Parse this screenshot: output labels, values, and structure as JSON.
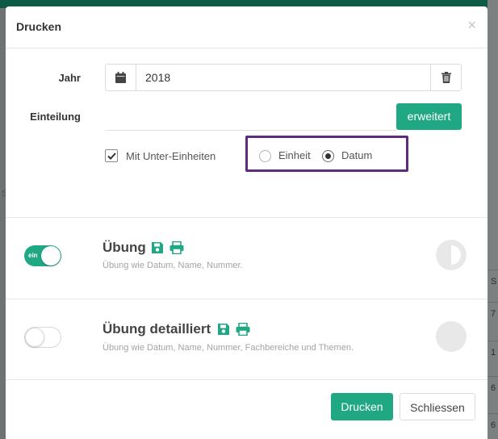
{
  "modal": {
    "title": "Drucken",
    "close": "×"
  },
  "form": {
    "year_label": "Jahr",
    "year_value": "2018",
    "einteilung_label": "Einteilung",
    "erweitert_button": "erweitert",
    "checkbox_label": "Mit Unter-Einheiten",
    "checkbox_checked": true,
    "radio_options": [
      {
        "label": "Einheit",
        "selected": false
      },
      {
        "label": "Datum",
        "selected": true
      }
    ]
  },
  "sections": [
    {
      "title": "Übung",
      "description": "Übung wie Datum, Name, Nummer.",
      "toggle_on": true,
      "toggle_text": "ein",
      "status": "half"
    },
    {
      "title": "Übung detailliert",
      "description": "Übung wie Datum, Name, Nummer, Fachbereiche und Themen.",
      "toggle_on": false,
      "status": "empty"
    }
  ],
  "footer": {
    "print_button": "Drucken",
    "close_button": "Schliessen"
  },
  "colors": {
    "accent": "#20a884",
    "highlight_box": "#5c2d7e",
    "topbar": "#0e5b45"
  },
  "background": {
    "left_letter": "S",
    "right_column": [
      "S",
      "7",
      "1",
      "6",
      "6"
    ]
  }
}
